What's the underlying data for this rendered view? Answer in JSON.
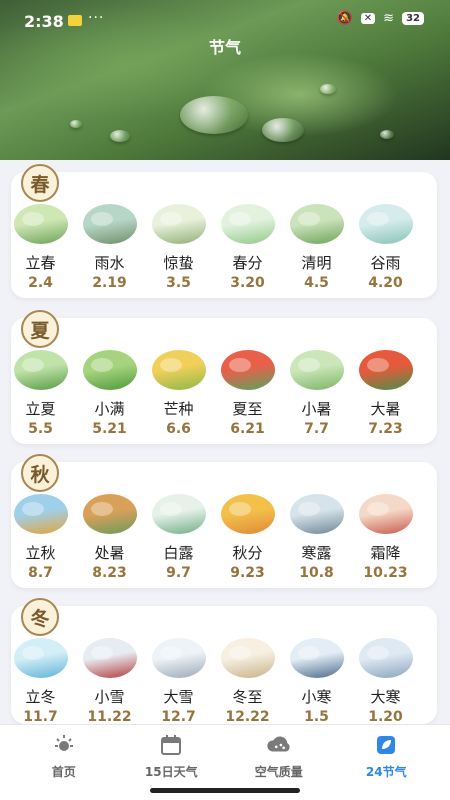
{
  "status": {
    "time": "2:38",
    "battery": "32",
    "dots": "···"
  },
  "header": {
    "title": "节气"
  },
  "seasons": [
    {
      "name": "春",
      "terms": [
        {
          "name": "立春",
          "date": "2.4",
          "colors": [
            "#cfe7b5",
            "#6ea35a"
          ]
        },
        {
          "name": "雨水",
          "date": "2.19",
          "colors": [
            "#b8d6c8",
            "#6f8f6a"
          ]
        },
        {
          "name": "惊蛰",
          "date": "3.5",
          "colors": [
            "#e9f1dc",
            "#8fae75"
          ]
        },
        {
          "name": "春分",
          "date": "3.20",
          "colors": [
            "#e2f2df",
            "#93c98a"
          ]
        },
        {
          "name": "清明",
          "date": "4.5",
          "colors": [
            "#cbe3bb",
            "#6ea35a"
          ]
        },
        {
          "name": "谷雨",
          "date": "4.20",
          "colors": [
            "#d6ecec",
            "#86c3b7"
          ]
        }
      ]
    },
    {
      "name": "夏",
      "terms": [
        {
          "name": "立夏",
          "date": "5.5",
          "colors": [
            "#bfe3a9",
            "#5a9a45"
          ]
        },
        {
          "name": "小满",
          "date": "5.21",
          "colors": [
            "#a7d37f",
            "#4f9a3a"
          ]
        },
        {
          "name": "芒种",
          "date": "6.6",
          "colors": [
            "#f0cf5a",
            "#8db84a"
          ]
        },
        {
          "name": "夏至",
          "date": "6.21",
          "colors": [
            "#e9604a",
            "#5aa55e"
          ]
        },
        {
          "name": "小暑",
          "date": "7.7",
          "colors": [
            "#cbe6b8",
            "#7cb466"
          ]
        },
        {
          "name": "大暑",
          "date": "7.23",
          "colors": [
            "#e55a3c",
            "#4a8f48"
          ]
        }
      ]
    },
    {
      "name": "秋",
      "terms": [
        {
          "name": "立秋",
          "date": "8.7",
          "colors": [
            "#9fd0ea",
            "#e2a53c"
          ]
        },
        {
          "name": "处暑",
          "date": "8.23",
          "colors": [
            "#d9a05a",
            "#6f9a5c"
          ]
        },
        {
          "name": "白露",
          "date": "9.7",
          "colors": [
            "#e6f1ea",
            "#6fae86"
          ]
        },
        {
          "name": "秋分",
          "date": "9.23",
          "colors": [
            "#f3c04a",
            "#e08a3a"
          ]
        },
        {
          "name": "寒露",
          "date": "10.8",
          "colors": [
            "#d7e3ea",
            "#6e8796"
          ]
        },
        {
          "name": "霜降",
          "date": "10.23",
          "colors": [
            "#f5d9c8",
            "#c9594a"
          ]
        }
      ]
    },
    {
      "name": "冬",
      "terms": [
        {
          "name": "立冬",
          "date": "11.7",
          "colors": [
            "#d3eef7",
            "#5fb3d6"
          ]
        },
        {
          "name": "小雪",
          "date": "11.22",
          "colors": [
            "#e7ecf2",
            "#b23c3c"
          ]
        },
        {
          "name": "大雪",
          "date": "12.7",
          "colors": [
            "#eef3f7",
            "#9aa8b6"
          ]
        },
        {
          "name": "冬至",
          "date": "12.22",
          "colors": [
            "#f6efe2",
            "#c8b289"
          ]
        },
        {
          "name": "小寒",
          "date": "1.5",
          "colors": [
            "#e3edf6",
            "#4a6a8a"
          ]
        },
        {
          "name": "大寒",
          "date": "1.20",
          "colors": [
            "#dfe9f3",
            "#8aa3bd"
          ]
        }
      ]
    }
  ],
  "tabs": [
    {
      "label": "首页",
      "icon": "sun-icon",
      "active": false
    },
    {
      "label": "15日天气",
      "icon": "calendar-icon",
      "active": false
    },
    {
      "label": "空气质量",
      "icon": "cloud-icon",
      "active": false
    },
    {
      "label": "24节气",
      "icon": "leaf-icon",
      "active": true
    }
  ],
  "colors": {
    "accent": "#2f88e6",
    "date": "#97733d",
    "badge_border": "#a8864e"
  }
}
